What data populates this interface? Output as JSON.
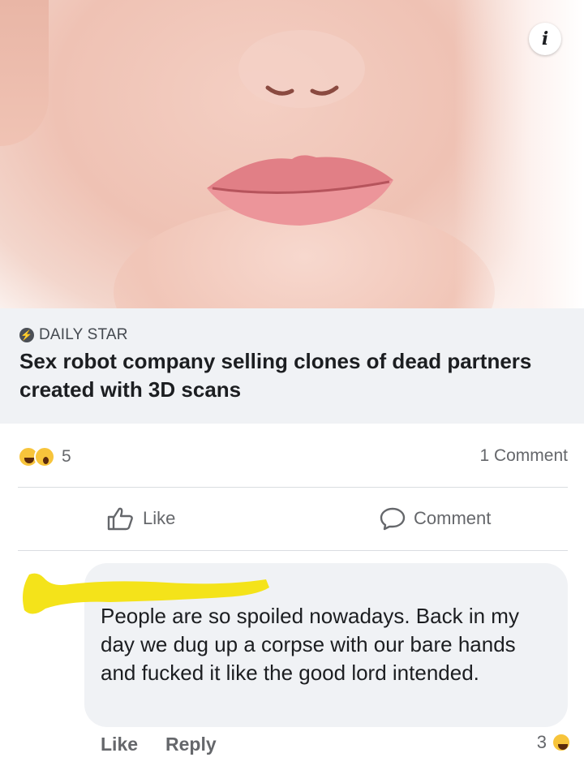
{
  "post": {
    "link": {
      "source": "DAILY STAR",
      "headline": "Sex robot company selling clones of dead partners created with 3D scans"
    },
    "reactions": {
      "icons": [
        "haha-emoji",
        "wow-emoji"
      ],
      "count": "5"
    },
    "comment_count": "1 Comment",
    "actions": {
      "like": "Like",
      "comment": "Comment"
    }
  },
  "comment": {
    "text": "People are so spoiled nowadays. Back in my day we dug up a corpse with our bare hands and fucked it like the good lord intended.",
    "actions": {
      "like": "Like",
      "reply": "Reply"
    },
    "reaction_count": "3"
  },
  "colors": {
    "redaction": "#f4e31a",
    "link_box": "#f0f2f5",
    "secondary_text": "#65676b"
  }
}
